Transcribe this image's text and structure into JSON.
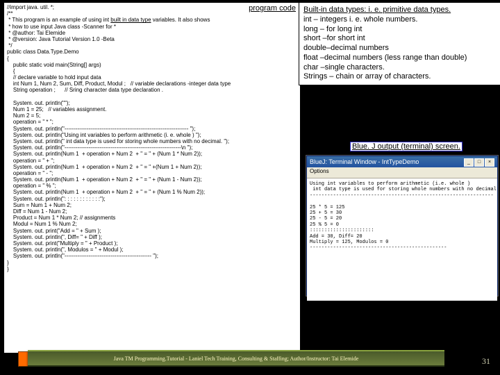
{
  "labels": {
    "program_code": "program code",
    "bluej": "Blue. J output (terminal) screen."
  },
  "code": {
    "l1": "//import java. util. *;",
    "l2": "/**",
    "l3": " * This program is an example of using int ",
    "l3u": "built in data type",
    "l3b": " variables. It also shows",
    "l4": " * how to use input Java class -Scanner for *",
    "l5": " * @author: Tai Elemide",
    "l6": " * @version: Java Tutorial Version 1.0 -Beta",
    "l7": " */",
    "l8": "public class Data.Type.Demo",
    "l9": "{",
    "l10": "    public static void main(String[] args)",
    "l11": "    {",
    "l12": "    // declare variable to hold input data",
    "l13": "    int Num 1, Num 2, Sum, Diff, Product, Modul ;   // variable declarations -integer data type",
    "l14": "    String operation ;      // Sring character data type declaration .",
    "blank1": " ",
    "l15": "    System. out. println(\"\");",
    "l16": "    Num 1 = 25;   // variables assignment.",
    "l17": "    Num 2 = 5;",
    "l18": "    operation = \" * \";",
    "l19": "    System. out. println(\"------------------------------------------------------------------- \");",
    "l20": "    System. out. println(\"Using int variables to perform arithmetic (i. e. whole ) \");",
    "l21": "    System. out. println(\" int data type is used for storing whole numbers with no decimal. \");",
    "l22": "    System. out. println(\"---------------------------------------------------------------\\n \");",
    "l23": "    System. out. println(Num 1  + operation + Num 2  + \" = \" + (Num 1 * Num 2));",
    "l24": "    operation = \" + \";",
    "l25": "    System. out. println(Num 1  + operation + Num 2  + \" = \" +(Num 1 + Num 2));",
    "l26": "    operation = \" - \";",
    "l27": "    System. out. println(Num 1  + operation + Num 2  + \" = \" + (Num 1 - Num 2));",
    "l28": "    operation = \" % \";",
    "l29": "    System. out. println(Num 1  + operation + Num 2  + \" = \" + (Num 1 % Num 2));",
    "l30": "    System. out. println(\": : : : : : : : : : : :\");",
    "l31": "    Sum = Num 1 + Num 2;",
    "l32": "    Diff = Num 1 - Num 2;",
    "l33": "    Product = Num 1 * Num 2; // assignments",
    "l34": "    Modul = Num 1 % Num 2;",
    "l35": "    System. out. print(\"Add = \" + Sum );",
    "l36": "    System. out. println(\", Diff= \" + Diff );",
    "l37": "    System. out. print(\"Multiply = \" + Product );",
    "l38": "    System. out. println(\", Modulos = \" + Modul );",
    "l39": "    System. out. println(\"----------------------------------------------- \");",
    "l40": "}",
    "l41": "}"
  },
  "datatypes": {
    "heading": "Built-in data types: i. e. primitive data types.",
    "r1": "int – integers i. e. whole numbers.",
    "r2": "long – for long int",
    "r3": "short –for short int",
    "r4": "double–decimal numbers",
    "r5": "float –decimal numbers (less range than double)",
    "r6": "char –single characters.",
    "r7": "Strings – chain or array of characters."
  },
  "terminal": {
    "title": "BlueJ:  Terminal Window - IntTypeDemo",
    "menu": "Options",
    "out1": "Using int variables to perform arithmetic (i.e. whole )",
    "out2": " int data type is used for storing whole numbers with no decimal.",
    "out3": "---------------------------------------------------------------",
    "out_blank": "",
    "out4": "25 * 5 = 125",
    "out5": "25 + 5 = 30",
    "out6": "25 - 5 = 20",
    "out7": "25 % 5 = 0",
    "out8": "::::::::::::::::::::::",
    "out9": "Add = 30, Diff= 20",
    "out10": "Multiply = 125, Modulos = 0",
    "out11": "-----------------------------------------------"
  },
  "footer": {
    "text": "Java TM Programming.Tutorial -  Laniel Tech Training, Consulting & Staffing; Author/Instructor: Tai Elemide",
    "slidenum": "31"
  }
}
